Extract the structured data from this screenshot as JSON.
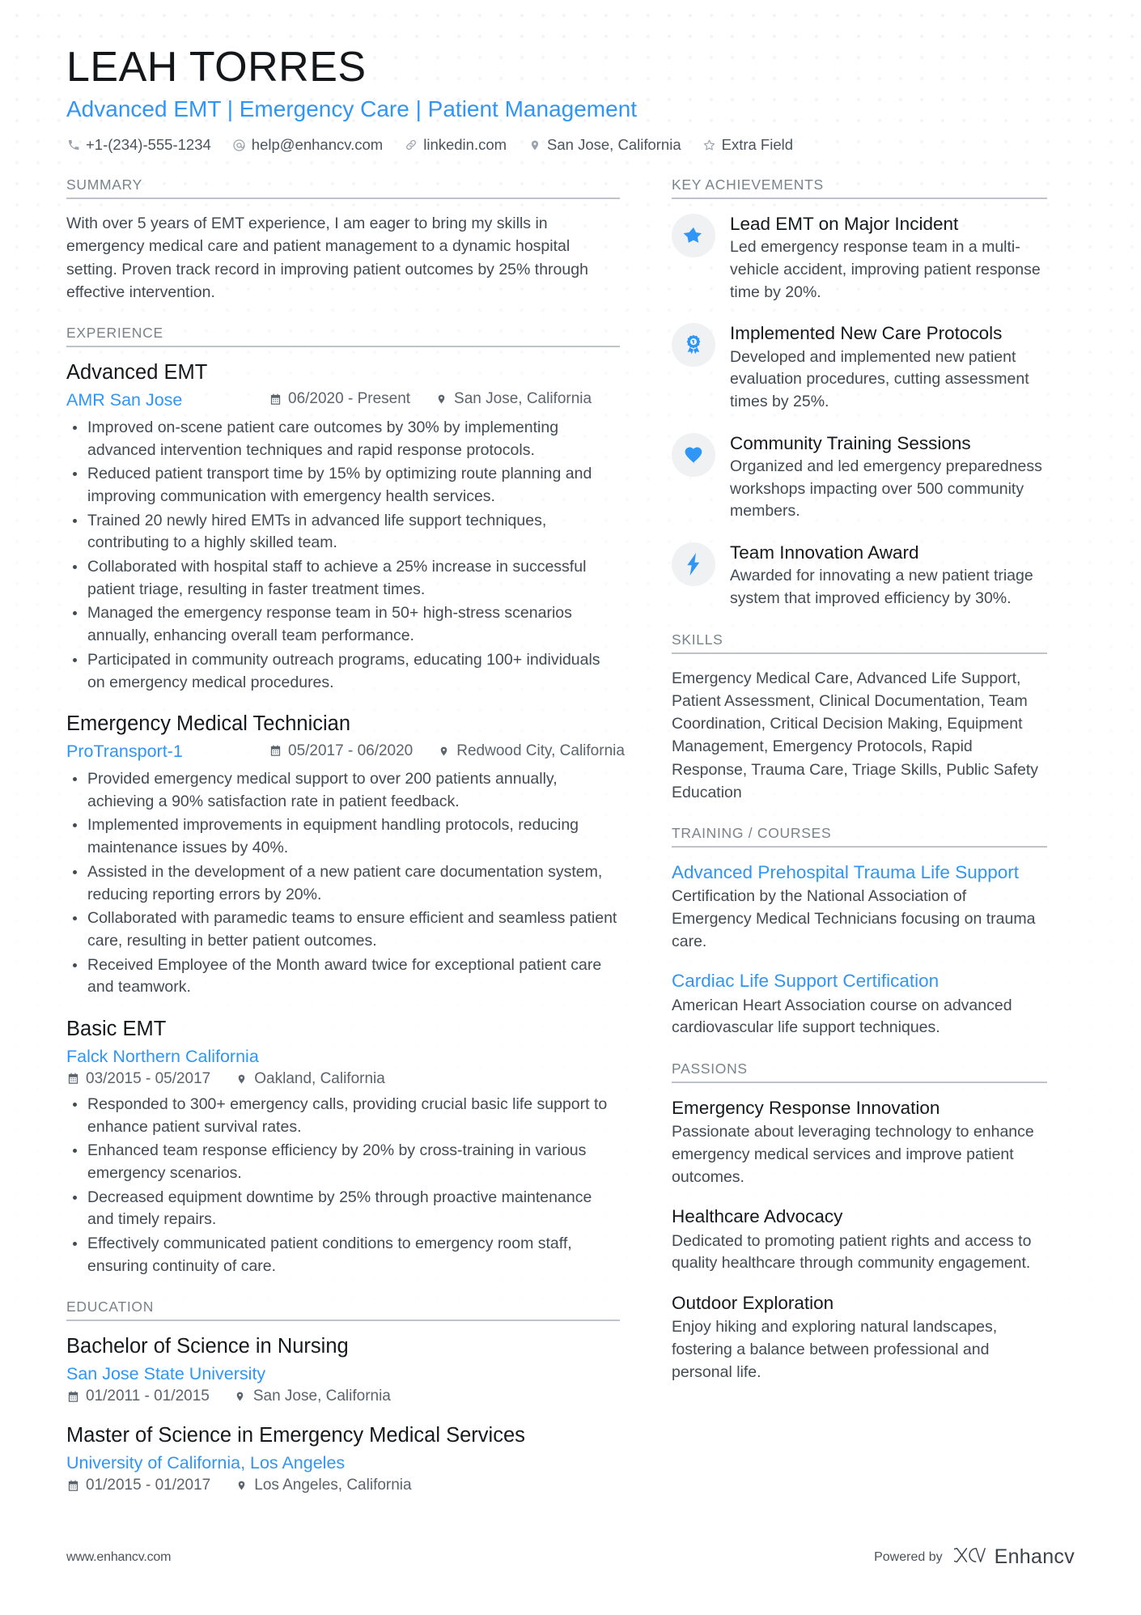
{
  "theme": {
    "accent": "#2f96f5",
    "heading": "#16191c",
    "body_text": "#424b53",
    "section_label": "#79838b",
    "rule": "#bdc3c8",
    "badge_bg": "#f0f1f2"
  },
  "header": {
    "name": "LEAH TORRES",
    "headline": "Advanced EMT | Emergency Care | Patient Management",
    "contacts": [
      {
        "icon": "phone-icon",
        "text": "+1-(234)-555-1234"
      },
      {
        "icon": "email-icon",
        "text": "help@enhancv.com"
      },
      {
        "icon": "link-icon",
        "text": "linkedin.com"
      },
      {
        "icon": "location-pin-icon",
        "text": "San Jose, California"
      },
      {
        "icon": "star-outline-icon",
        "text": "Extra Field"
      }
    ]
  },
  "left": {
    "summary": {
      "title": "SUMMARY",
      "text": "With over 5 years of EMT experience, I am eager to bring my skills in emergency medical care and patient management to a dynamic hospital setting. Proven track record in improving patient outcomes by 25% through effective intervention."
    },
    "experience": {
      "title": "EXPERIENCE",
      "entries": [
        {
          "role": "Advanced EMT",
          "company": "AMR San Jose",
          "dates": "06/2020 - Present",
          "location": "San Jose, California",
          "bullets": [
            "Improved on-scene patient care outcomes by 30% by implementing advanced intervention techniques and rapid response protocols.",
            "Reduced patient transport time by 15% by optimizing route planning and improving communication with emergency health services.",
            "Trained 20 newly hired EMTs in advanced life support techniques, contributing to a highly skilled team.",
            "Collaborated with hospital staff to achieve a 25% increase in successful patient triage, resulting in faster treatment times.",
            "Managed the emergency response team in 50+ high-stress scenarios annually, enhancing overall team performance.",
            "Participated in community outreach programs, educating 100+ individuals on emergency medical procedures."
          ]
        },
        {
          "role": "Emergency Medical Technician",
          "company": "ProTransport-1",
          "dates": "05/2017 - 06/2020",
          "location": "Redwood City, California",
          "bullets": [
            "Provided emergency medical support to over 200 patients annually, achieving a 90% satisfaction rate in patient feedback.",
            "Implemented improvements in equipment handling protocols, reducing maintenance issues by 40%.",
            "Assisted in the development of a new patient care documentation system, reducing reporting errors by 20%.",
            "Collaborated with paramedic teams to ensure efficient and seamless patient care, resulting in better patient outcomes.",
            "Received Employee of the Month award twice for exceptional patient care and teamwork."
          ]
        },
        {
          "role": "Basic EMT",
          "company": "Falck Northern California",
          "dates": "03/2015 - 05/2017",
          "location": "Oakland, California",
          "bullets": [
            "Responded to 300+ emergency calls, providing crucial basic life support to enhance patient survival rates.",
            "Enhanced team response efficiency by 20% by cross-training in various emergency scenarios.",
            "Decreased equipment downtime by 25% through proactive maintenance and timely repairs.",
            "Effectively communicated patient conditions to emergency room staff, ensuring continuity of care."
          ]
        }
      ]
    },
    "education": {
      "title": "EDUCATION",
      "entries": [
        {
          "degree": "Bachelor of Science in Nursing",
          "school": "San Jose State University",
          "dates": "01/2011 - 01/2015",
          "location": "San Jose, California"
        },
        {
          "degree": "Master of Science in Emergency Medical Services",
          "school": "University of California, Los Angeles",
          "dates": "01/2015 - 01/2017",
          "location": "Los Angeles, California"
        }
      ]
    }
  },
  "right": {
    "achievements": {
      "title": "KEY ACHIEVEMENTS",
      "items": [
        {
          "icon": "star-icon",
          "title": "Lead EMT on Major Incident",
          "desc": "Led emergency response team in a multi-vehicle accident, improving patient response time by 20%."
        },
        {
          "icon": "award-ribbon-icon",
          "title": "Implemented New Care Protocols",
          "desc": "Developed and implemented new patient evaluation procedures, cutting assessment times by 25%."
        },
        {
          "icon": "heart-icon",
          "title": "Community Training Sessions",
          "desc": "Organized and led emergency preparedness workshops impacting over 500 community members."
        },
        {
          "icon": "lightning-bolt-icon",
          "title": "Team Innovation Award",
          "desc": "Awarded for innovating a new patient triage system that improved efficiency by 30%."
        }
      ]
    },
    "skills": {
      "title": "SKILLS",
      "text": "Emergency Medical Care, Advanced Life Support, Patient Assessment, Clinical Documentation, Team Coordination, Critical Decision Making, Equipment Management, Emergency Protocols, Rapid Response, Trauma Care, Triage Skills, Public Safety Education"
    },
    "training": {
      "title": "TRAINING / COURSES",
      "items": [
        {
          "name": "Advanced Prehospital Trauma Life Support",
          "desc": "Certification by the National Association of Emergency Medical Technicians focusing on trauma care."
        },
        {
          "name": "Cardiac Life Support Certification",
          "desc": "American Heart Association course on advanced cardiovascular life support techniques."
        }
      ]
    },
    "passions": {
      "title": "PASSIONS",
      "items": [
        {
          "name": "Emergency Response Innovation",
          "desc": "Passionate about leveraging technology to enhance emergency medical services and improve patient outcomes."
        },
        {
          "name": "Healthcare Advocacy",
          "desc": "Dedicated to promoting patient rights and access to quality healthcare through community engagement."
        },
        {
          "name": "Outdoor Exploration",
          "desc": "Enjoy hiking and exploring natural landscapes, fostering a balance between professional and personal life."
        }
      ]
    }
  },
  "footer": {
    "url": "www.enhancv.com",
    "powered_by": "Powered by",
    "brand": "Enhancv"
  }
}
